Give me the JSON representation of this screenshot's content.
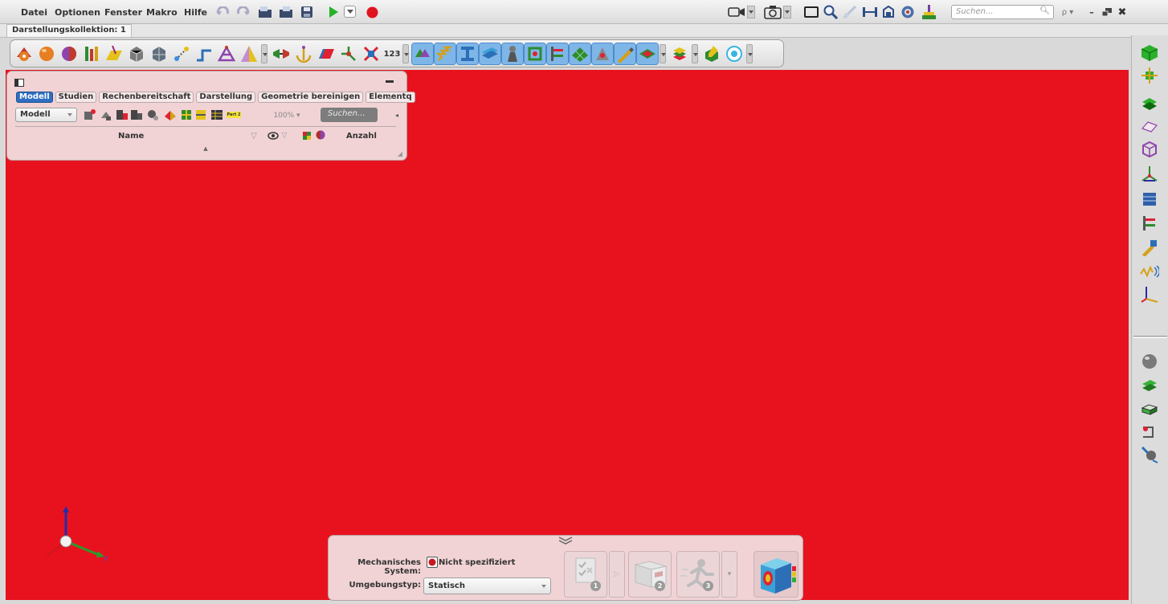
{
  "menu": [
    "Datei",
    "Optionen",
    "Fenster",
    "Makro",
    "Hilfe"
  ],
  "search": {
    "placeholder": "Suchen..."
  },
  "document_tab": "Darstellungskollektion: 1",
  "main_toolbar": {
    "counter_label": "123"
  },
  "model_panel": {
    "tabs": [
      "Modell",
      "Studien",
      "Rechenbereitschaft",
      "Darstellung",
      "Geometrie bereinigen",
      "Elementq"
    ],
    "active_tab": "Modell",
    "filter_combo": "Modell",
    "zoom": "100%",
    "part_label": "Part 2",
    "search_placeholder": "Suchen...",
    "columns": {
      "name": "Name",
      "count": "Anzahl"
    }
  },
  "triad": {
    "y_label": "Y"
  },
  "guide_bar": {
    "mech_label": "Mechanisches System:",
    "mech_value": "Nicht spezifiziert",
    "env_label": "Umgebungstyp:",
    "env_value": "Statisch",
    "step_badges": [
      "1",
      "2",
      "3"
    ]
  },
  "colors": {
    "viewport": "#e8121e",
    "panel": "#f1d3d5",
    "tab_active": "#2f6fc1",
    "accent_blue": "#7fb6e8"
  }
}
